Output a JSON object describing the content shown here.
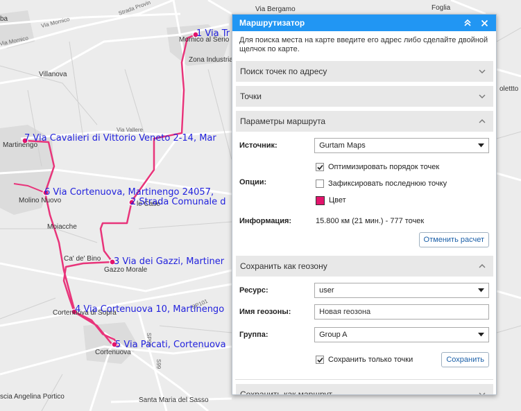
{
  "map": {
    "places": {
      "mornico": "Mornico al Serio",
      "zona_industriale": "Zona Industriale",
      "villanova": "Villanova",
      "martinengo": "Martinengo",
      "molino_nuovo": "Molino Nuovo",
      "moiacche": "Moiacche",
      "ca_de_bino": "Ca' de' Bino",
      "gazzo_morale": "Gazzo Morale",
      "le_case": "le Case",
      "cortenuova_sopra": "Cortenuova di Sopra",
      "cortenuova": "Cortenuova",
      "via_bergamo": "Via Bergamo",
      "foglia": "Foglia",
      "santa_maria": "Santa Maria del Sasso",
      "santa_angelina": "scia Angelina Portico",
      "zolettto": "olettto",
      "ba": "ba"
    },
    "roads": {
      "via_mornico": "Via Mornico",
      "strada_provinciale": "Strada Provin",
      "via_mornico2": "Via Mornico",
      "via_vallere": "Via Vallere",
      "sp101": "SP101",
      "sp99": "SP99",
      "s99": "S99"
    },
    "waypoints": [
      {
        "label": "1 Via Tr"
      },
      {
        "label": "2 Strada Comunale d"
      },
      {
        "label": "3 Via dei Gazzi, Martiner"
      },
      {
        "label": "4 Via Cortenuova 10, Martinengo"
      },
      {
        "label": "5 Via Pacati, Cortenuova"
      },
      {
        "label": "6 Via Cortenuova, Martinengo 24057,"
      },
      {
        "label": "7 Via Cavalieri di Vittorio Veneto 2-14, Mar"
      }
    ],
    "route_color": "#e8347a"
  },
  "panel": {
    "title": "Маршрутизатор",
    "hint": "Для поиска места на карте введите его адрес либо сделайте двойной щелчок по карте.",
    "sections": {
      "address_search": "Поиск точек по адресу",
      "points": "Точки",
      "route_params": "Параметры маршрута",
      "save_geofence": "Сохранить как геозону",
      "save_route": "Сохранить как маршрут"
    },
    "route": {
      "source_label": "Источник:",
      "source_value": "Gurtam Maps",
      "options_label": "Опции:",
      "opt_optimize": "Оптимизировать порядок точек",
      "opt_fix_last": "Зафиксировать последнюю точку",
      "opt_color": "Цвет",
      "info_label": "Информация:",
      "info_value": "15.800 км (21 мин.) - 777 точек",
      "cancel_btn": "Отменить расчет",
      "color": "#e2146c"
    },
    "geofence": {
      "resource_label": "Ресурс:",
      "resource_value": "user",
      "name_label": "Имя геозоны:",
      "name_value": "Новая геозона",
      "group_label": "Группа:",
      "group_value": "Group A",
      "points_only": "Сохранить только точки",
      "save_btn": "Сохранить"
    }
  }
}
